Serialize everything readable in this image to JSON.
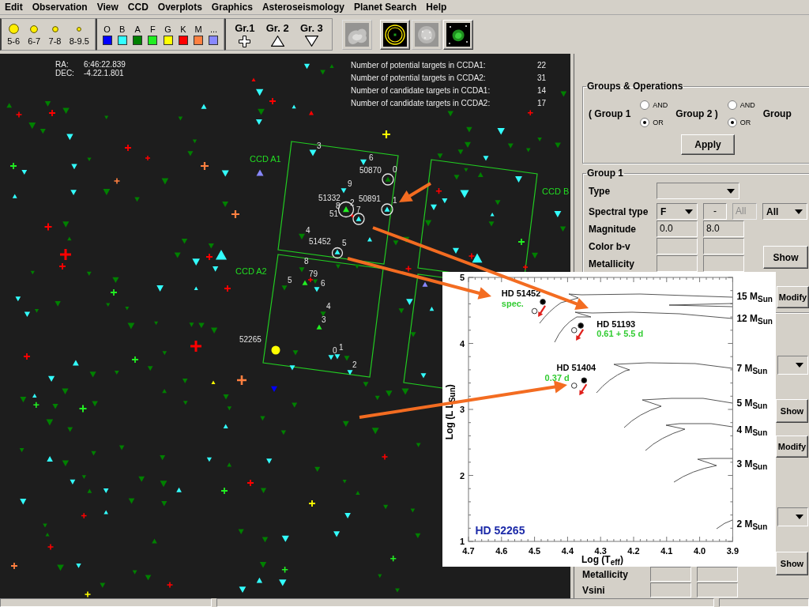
{
  "menu": [
    "Edit",
    "Observation",
    "View",
    "CCD",
    "Overplots",
    "Graphics",
    "Asteroseismology",
    "Planet Search",
    "Help"
  ],
  "toolbar": {
    "magnitudes": [
      {
        "label": "5-6"
      },
      {
        "label": "6-7"
      },
      {
        "label": "7-8"
      },
      {
        "label": "8-9.5"
      }
    ],
    "spectral_types": [
      {
        "label": "O",
        "color": "#0000ff"
      },
      {
        "label": "B",
        "color": "#33ffff"
      },
      {
        "label": "A",
        "color": "#008000"
      },
      {
        "label": "F",
        "color": "#22ee22"
      },
      {
        "label": "G",
        "color": "#ffff00"
      },
      {
        "label": "K",
        "color": "#ff0000"
      },
      {
        "label": "M",
        "color": "#ff8040"
      },
      {
        "label": "...",
        "color": "#8888ff"
      }
    ],
    "groups": [
      {
        "label": "Gr.1",
        "kind": "cross"
      },
      {
        "label": "Gr. 2",
        "kind": "up"
      },
      {
        "label": "Gr. 3",
        "kind": "down"
      }
    ],
    "view_buttons": [
      {
        "kind": "nebula",
        "disabled": true
      },
      {
        "kind": "rings",
        "disabled": false
      },
      {
        "kind": "cluster",
        "disabled": true
      },
      {
        "kind": "galaxy",
        "disabled": false
      }
    ]
  },
  "sky": {
    "ra_label": "RA:",
    "ra": "6:46:22.839",
    "dec_label": "DEC:",
    "dec": "-4.22.1.801",
    "counts": [
      {
        "label": "Number of potential targets in CCDA1:",
        "value": "22"
      },
      {
        "label": "Number of potential targets in CCDA2:",
        "value": "31"
      },
      {
        "label": "Number of candidate targets in CCDA1:",
        "value": "14"
      },
      {
        "label": "Number of candidate targets in CCDA2:",
        "value": "17"
      }
    ],
    "ccd_labels": [
      "CCD A1",
      "CCD A2",
      "CCD B"
    ],
    "star_labels": [
      "3",
      "6",
      "50870",
      "0",
      "9",
      "51332",
      "8",
      "2",
      "51",
      "7",
      "50891",
      "1",
      "4",
      "51452",
      "5",
      "8",
      "79",
      "5",
      "6",
      "4",
      "3",
      "52265",
      "0",
      "1",
      "2"
    ]
  },
  "right_panel": {
    "operations": {
      "title": "Groups & Operations",
      "items": [
        {
          "kind": "text",
          "label": "( Group 1"
        },
        {
          "kind": "radio",
          "options": [
            {
              "label": "AND",
              "selected": false
            },
            {
              "label": "OR",
              "selected": true
            }
          ]
        },
        {
          "kind": "text",
          "label": "Group 2 )"
        },
        {
          "kind": "radio",
          "options": [
            {
              "label": "AND",
              "selected": false
            },
            {
              "label": "OR",
              "selected": true
            }
          ]
        },
        {
          "kind": "text",
          "label": "Group"
        }
      ],
      "apply": "Apply"
    },
    "group_1": {
      "title": "Group 1",
      "rows": [
        {
          "label": "Type",
          "fields": [
            {
              "kind": "combo"
            }
          ]
        },
        {
          "label": "Spectral type",
          "fields": [
            {
              "kind": "dropdown",
              "value": "F"
            },
            {
              "kind": "field",
              "value": "-",
              "disabled": false
            },
            {
              "kind": "field",
              "value": "All",
              "disabled": true
            },
            {
              "kind": "dropdown",
              "value": "All"
            }
          ]
        },
        {
          "label": "Magnitude",
          "fields": [
            {
              "kind": "field",
              "value": "0.0",
              "disabled": false
            },
            {
              "kind": "field",
              "value": "8.0",
              "disabled": false
            }
          ]
        },
        {
          "label": "Color b-v",
          "fields": [
            {
              "kind": "field",
              "disabled": false
            },
            {
              "kind": "field",
              "disabled": false
            }
          ]
        },
        {
          "label": "Metallicity",
          "fields": [
            {
              "kind": "field",
              "disabled": false
            },
            {
              "kind": "field",
              "disabled": false
            }
          ]
        }
      ],
      "buttons": [
        "Show",
        "Modify"
      ]
    },
    "edge_controls": [
      {
        "kind": "dropdown"
      },
      {
        "kind": "button",
        "label": "Show"
      },
      {
        "kind": "button",
        "label": "Modify"
      },
      {
        "kind": "dropdown"
      }
    ],
    "lower_group": {
      "rows": [
        {
          "label": "Metallicity",
          "fields": [
            {
              "kind": "field",
              "disabled": false
            },
            {
              "kind": "field",
              "disabled": false
            }
          ]
        },
        {
          "label": "Vsini",
          "fields": [
            {
              "kind": "field",
              "disabled": false
            },
            {
              "kind": "field",
              "disabled": false
            }
          ]
        }
      ],
      "button": "Show"
    }
  },
  "inset": {
    "chart_data": {
      "type": "scatter",
      "xlabel": "Log (T$_{eff}$)",
      "ylabel": "Log (L L$_{Sun}$)",
      "x": [
        4.475,
        4.5,
        4.36,
        4.38,
        4.35,
        4.38
      ],
      "series": [
        {
          "color": "#000000",
          "values": [
            4.63,
            null,
            4.27,
            null,
            3.44,
            null
          ]
        },
        {
          "color": "#ffffff",
          "values": [
            null,
            4.49,
            null,
            4.2,
            null,
            3.36
          ]
        }
      ],
      "xlim": [
        4.7,
        3.9
      ],
      "ylim": [
        1,
        5
      ],
      "xticks": [
        4.7,
        4.6,
        4.5,
        4.4,
        4.3,
        4.2,
        4.1,
        {
          "value": 4,
          "label": "4.0"
        },
        3.9
      ],
      "yticks": [
        1,
        2,
        3,
        4,
        5
      ],
      "annotations": [
        "HD 51452",
        "spec.",
        "HD 51193",
        "0.61 + 5.5 d",
        "HD 51404",
        "0.37 d",
        "HD 52265",
        "15 M$_{Sun}$",
        "12 M$_{Sun}$",
        "7 M$_{Sun}$",
        "5 M$_{Sun}$",
        "4 M$_{Sun}$",
        "3 M$_{Sun}$",
        "2 M$_{Sun}$"
      ]
    }
  }
}
